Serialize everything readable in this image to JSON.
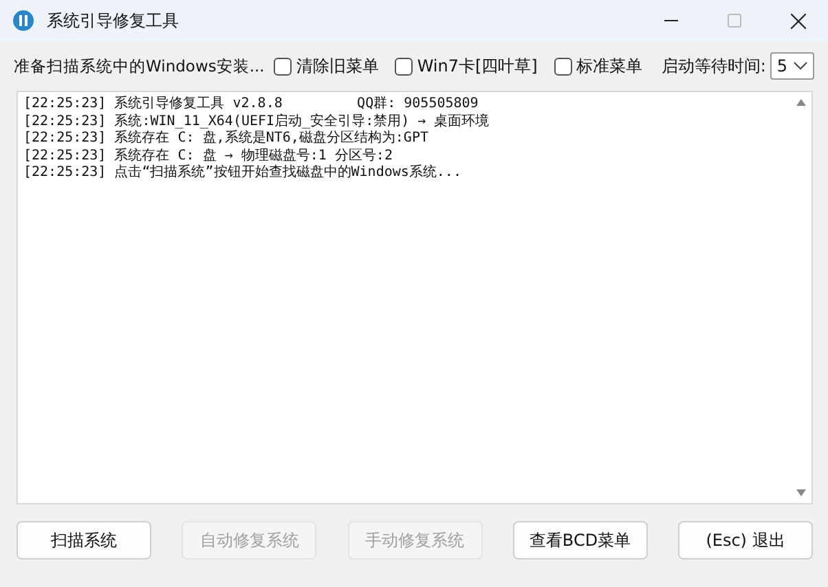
{
  "window": {
    "title": "系统引导修复工具"
  },
  "toolbar": {
    "status": "准备扫描系统中的Windows安装...",
    "options": [
      {
        "label": "清除旧菜单",
        "checked": false
      },
      {
        "label": "Win7卡[四叶草]",
        "checked": false
      },
      {
        "label": "标准菜单",
        "checked": false
      }
    ],
    "wait_label": "启动等待时间:",
    "wait_value": "5"
  },
  "log": [
    "[22:25:23] 系统引导修复工具 v2.8.8         QQ群: 905505809",
    "[22:25:23] 系统:WIN_11_X64(UEFI启动_安全引导:禁用) → 桌面环境",
    "[22:25:23] 系统存在 C: 盘,系统是NT6,磁盘分区结构为:GPT",
    "[22:25:23] 系统存在 C: 盘 → 物理磁盘号:1 分区号:2",
    "[22:25:23] 点击“扫描系统”按钮开始查找磁盘中的Windows系统..."
  ],
  "buttons": [
    {
      "label": "扫描系统",
      "disabled": false
    },
    {
      "label": "自动修复系统",
      "disabled": true
    },
    {
      "label": "手动修复系统",
      "disabled": true
    },
    {
      "label": "查看BCD菜单",
      "disabled": false
    },
    {
      "label": "(Esc) 退出",
      "disabled": false
    }
  ]
}
